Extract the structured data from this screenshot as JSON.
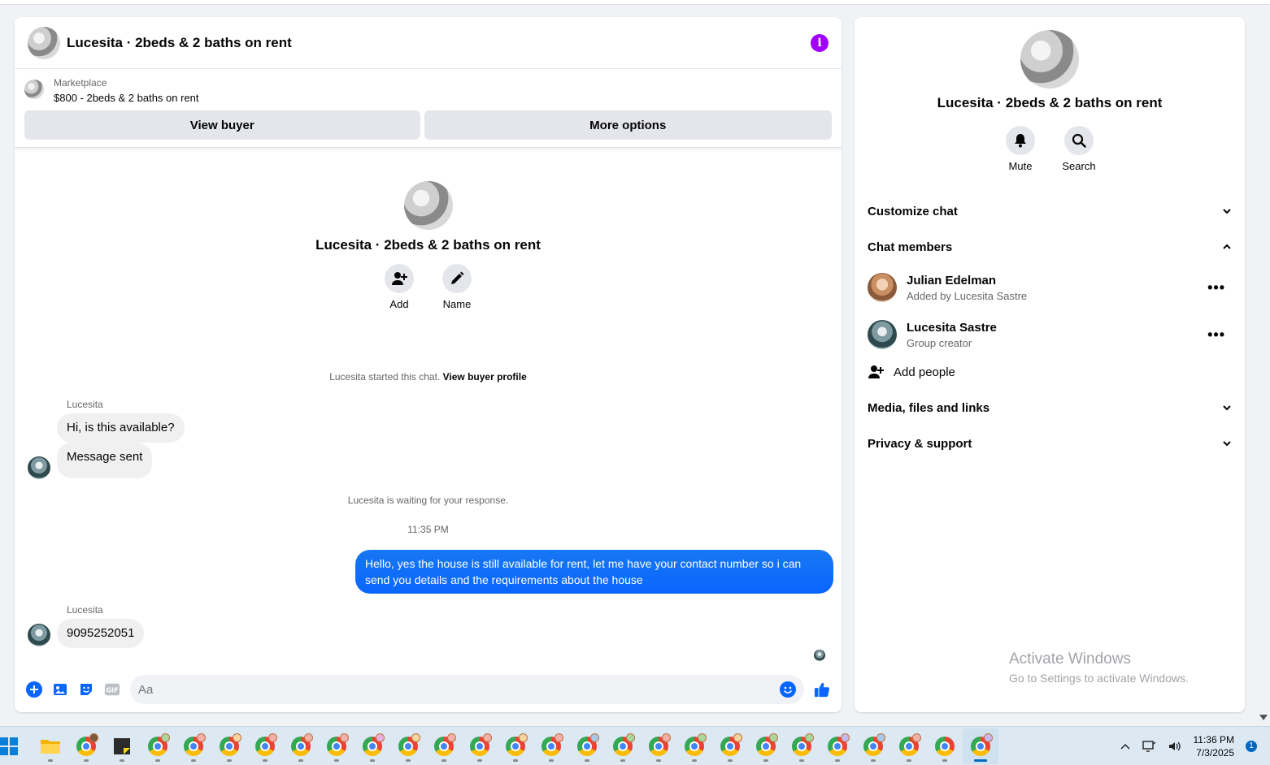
{
  "chat": {
    "title": "Lucesita · 2beds & 2 baths on rent",
    "marketplace_label": "Marketplace",
    "listing": "$800 - 2beds & 2 baths on rent",
    "view_buyer_label": "View buyer",
    "more_options_label": "More options",
    "intro_title": "Lucesita · 2beds & 2 baths on rent",
    "add_label": "Add",
    "name_label": "Name",
    "started_text": "Lucesita started this chat.",
    "view_buyer_profile": "View buyer profile",
    "waiting_text": "Lucesita is waiting for your response.",
    "timestamp": "11:35 PM",
    "messages": [
      {
        "sender": "Lucesita",
        "text": "Hi, is this available?"
      },
      {
        "text": "Message sent"
      },
      {
        "text": "Hello, yes the house is still available for rent, let me have your contact number so i can send you details and the requirements about the house"
      },
      {
        "sender": "Lucesita",
        "text": "9095252051"
      }
    ],
    "input_placeholder": "Aa"
  },
  "sidebar": {
    "title": "Lucesita · 2beds & 2 baths on rent",
    "mute_label": "Mute",
    "search_label": "Search",
    "customize_chat": "Customize chat",
    "chat_members": "Chat members",
    "members": [
      {
        "name": "Julian Edelman",
        "sub": "Added by Lucesita Sastre"
      },
      {
        "name": "Lucesita Sastre",
        "sub": "Group creator"
      }
    ],
    "add_people": "Add people",
    "media_files_links": "Media, files and links",
    "privacy_support": "Privacy & support",
    "activate_title": "Activate Windows",
    "activate_sub": "Go to Settings to activate Windows."
  },
  "taskbar": {
    "time": "11:36 PM",
    "date": "7/3/2025",
    "notification_count": "1"
  },
  "colors": {
    "accent": "#0866ff",
    "info": "#a100ff"
  }
}
